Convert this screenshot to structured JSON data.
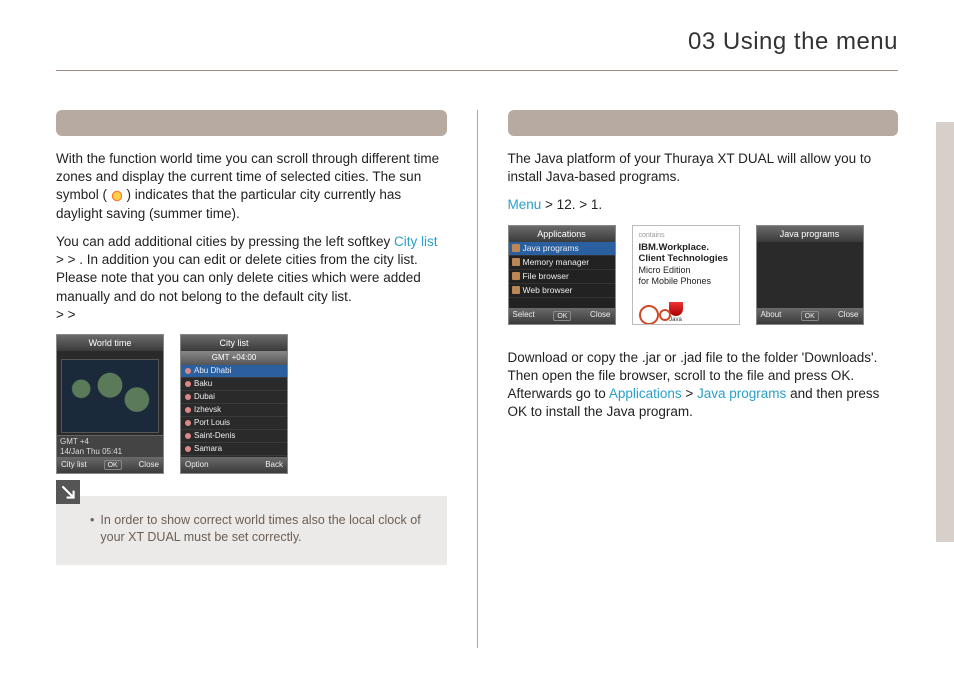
{
  "header": {
    "title": "03 Using the menu"
  },
  "left": {
    "p1_a": "With the function world time you can scroll through different time zones and display the current time of selected cities. The sun symbol ( ",
    "p1_b": " ) indicates that the particular city currently has daylight saving (summer time).",
    "p2_a": "You can add additional cities by pressing the left softkey ",
    "p2_city_list": "City list",
    "p2_b": " > ",
    "p2_c": " > ",
    "p2_d": ". In addition you can edit or delete cities from the city list. Please note that you can only delete cities which were added manually and do not belong to the default city list.",
    "p2_e": " > ",
    "p2_f": " > ",
    "phone1": {
      "title": "World time",
      "strip1": "GMT +4",
      "strip2": "14/Jan Thu 05:41",
      "foot_l": "City list",
      "foot_m": "OK",
      "foot_r": "Close"
    },
    "phone2": {
      "title": "City list",
      "top": "GMT +04:00",
      "items": [
        "Abu Dhabi",
        "Baku",
        "Dubai",
        "Izhevsk",
        "Port Louis",
        "Saint-Denis",
        "Samara"
      ],
      "foot_l": "Option",
      "foot_r": "Back"
    },
    "note": "In order to show correct world times also the local clock of your XT DUAL must be set correctly."
  },
  "right": {
    "p1": "The Java platform of your Thuraya XT DUAL will allow you to install Java-based programs.",
    "nav_menu": "Menu",
    "nav_a": " > 12. ",
    "nav_b": " > 1. ",
    "phone1": {
      "title": "Applications",
      "items": [
        "Java programs",
        "Memory manager",
        "File browser",
        "Web browser"
      ],
      "foot_l": "Select",
      "foot_m": "OK",
      "foot_r": "Close"
    },
    "phone2": {
      "contains": "contains",
      "l1": "IBM.Workplace.",
      "l2": "Client Technologies",
      "l3": "Micro Edition",
      "l4": "for Mobile Phones",
      "java": "Java"
    },
    "phone3": {
      "title": "Java programs",
      "foot_l": "About",
      "foot_m": "OK",
      "foot_r": "Close"
    },
    "p2_a": "Download or copy the .jar or .jad file to the folder 'Downloads'. Then open the file browser, scroll to the file and press OK. Afterwards go to ",
    "p2_apps": "Applications",
    "p2_gt": " > ",
    "p2_java": "Java programs",
    "p2_b": " and then press OK to install the Java program."
  }
}
